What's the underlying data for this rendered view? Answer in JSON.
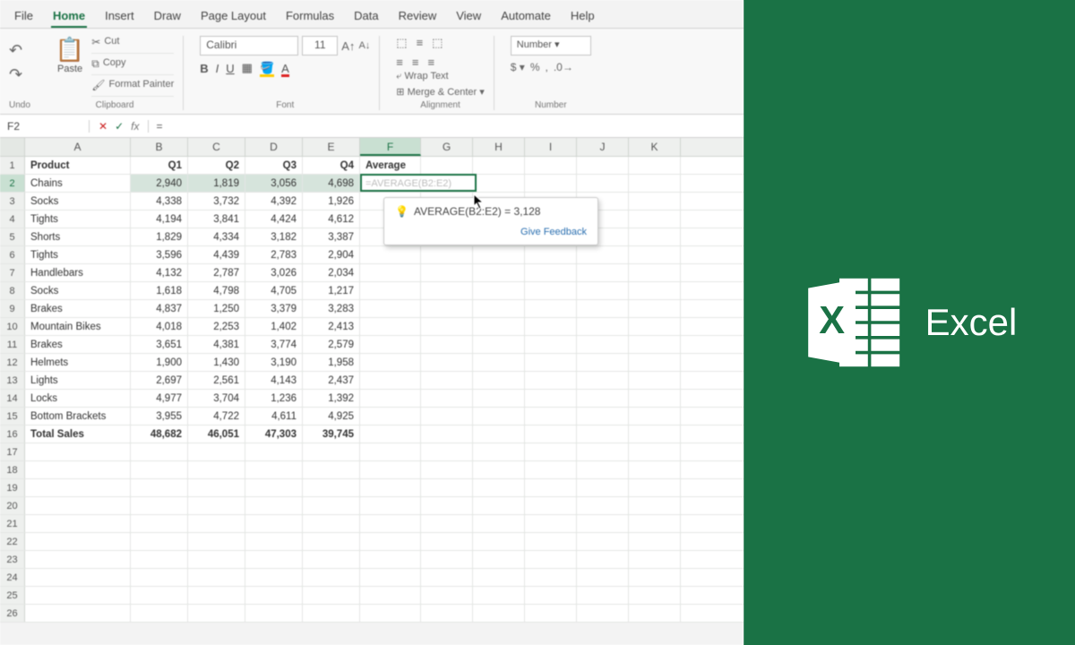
{
  "brand": {
    "label": "Excel"
  },
  "tabs": [
    "File",
    "Home",
    "Insert",
    "Draw",
    "Page Layout",
    "Formulas",
    "Data",
    "Review",
    "View",
    "Automate",
    "Help"
  ],
  "active_tab": "Home",
  "ribbon": {
    "undo_group": "Undo",
    "paste": "Paste",
    "cut": "Cut",
    "copy": "Copy",
    "format_painter": "Format Painter",
    "clipboard_group": "Clipboard",
    "font_name": "Calibri",
    "font_size": "11",
    "font_group": "Font",
    "wrap_text": "Wrap Text",
    "merge_center": "Merge & Center",
    "alignment_group": "Alignment",
    "number_format": "Number",
    "number_group": "Number"
  },
  "formula_bar": {
    "cell_ref": "F2",
    "fx": "fx",
    "formula": "="
  },
  "columns": [
    "A",
    "B",
    "C",
    "D",
    "E",
    "F",
    "G",
    "H",
    "I",
    "J",
    "K"
  ],
  "selected_col": "F",
  "selected_row": 2,
  "headers": {
    "product": "Product",
    "q1": "Q1",
    "q2": "Q2",
    "q3": "Q3",
    "q4": "Q4",
    "avg": "Average"
  },
  "rows": [
    {
      "p": "Chains",
      "q": [
        2940,
        1819,
        3056,
        4698
      ]
    },
    {
      "p": "Socks",
      "q": [
        4338,
        3732,
        4392,
        1926
      ]
    },
    {
      "p": "Tights",
      "q": [
        4194,
        3841,
        4424,
        4612
      ]
    },
    {
      "p": "Shorts",
      "q": [
        1829,
        4334,
        3182,
        3387
      ]
    },
    {
      "p": "Tights",
      "q": [
        3596,
        4439,
        2783,
        2904
      ]
    },
    {
      "p": "Handlebars",
      "q": [
        4132,
        2787,
        3026,
        2034
      ]
    },
    {
      "p": "Socks",
      "q": [
        1618,
        4798,
        4705,
        1217
      ]
    },
    {
      "p": "Brakes",
      "q": [
        4837,
        1250,
        3379,
        3283
      ]
    },
    {
      "p": "Mountain Bikes",
      "q": [
        4018,
        2253,
        1402,
        2413
      ]
    },
    {
      "p": "Brakes",
      "q": [
        3651,
        4381,
        3774,
        2579
      ]
    },
    {
      "p": "Helmets",
      "q": [
        1900,
        1430,
        3190,
        1958
      ]
    },
    {
      "p": "Lights",
      "q": [
        2697,
        2561,
        4143,
        2437
      ]
    },
    {
      "p": "Locks",
      "q": [
        4977,
        3704,
        1236,
        1392
      ]
    },
    {
      "p": "Bottom Brackets",
      "q": [
        3955,
        4722,
        4611,
        4925
      ]
    }
  ],
  "totals": {
    "label": "Total Sales",
    "q": [
      48682,
      46051,
      47303,
      39745
    ]
  },
  "active_cell": {
    "ghost": "=AVERAGE(B2:E2)"
  },
  "tooltip": {
    "text": "AVERAGE(B2:E2) = 3,128",
    "feedback": "Give Feedback"
  }
}
